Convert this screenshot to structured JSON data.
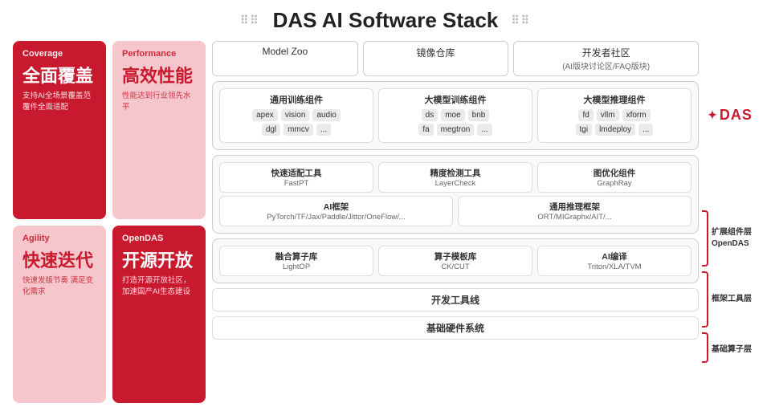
{
  "title": "DAS AI Software Stack",
  "grid_icon": "⠿",
  "left_panel": {
    "top_left": {
      "label": "Coverage",
      "title": "全面覆盖",
      "desc": "支持AI全场景覆盖范\n覆件全面适配"
    },
    "top_right": {
      "label": "Performance",
      "title": "高效性能",
      "desc": "性能达到行业领先水平"
    },
    "bottom_left": {
      "label": "Agility",
      "title": "快速迭代",
      "desc": "快速发版节奏\n满足变化需求"
    },
    "bottom_right": {
      "label": "OpenDAS",
      "title": "开源开放",
      "desc": "打造开源开放社区，\n加速国产AI生态建设"
    }
  },
  "top_boxes": [
    {
      "text": "Model Zoo",
      "sub": ""
    },
    {
      "text": "镜像仓库",
      "sub": ""
    },
    {
      "text": "开发者社区",
      "sub": "(AI版块讨论区/FAQ版块)"
    }
  ],
  "expand_section": {
    "label": "扩展组件层\nOpenDAS",
    "cols": [
      {
        "title": "通用训练组件",
        "rows": [
          [
            "apex",
            "vision",
            "audio"
          ],
          [
            "dgl",
            "mmcv",
            "..."
          ]
        ]
      },
      {
        "title": "大模型训练组件",
        "rows": [
          [
            "ds",
            "moe",
            "bnb"
          ],
          [
            "fa",
            "megtron",
            "..."
          ]
        ]
      },
      {
        "title": "大模型推理组件",
        "rows": [
          [
            "fd",
            "vllm",
            "xform"
          ],
          [
            "tgi",
            "lmdeploy",
            "..."
          ]
        ]
      }
    ]
  },
  "framework_section": {
    "label": "框架工具层",
    "tools": [
      {
        "title": "快速适配工具",
        "sub": "FastPT"
      },
      {
        "title": "精度检测工具",
        "sub": "LayerCheck"
      },
      {
        "title": "图优化组件",
        "sub": "GraphRay"
      }
    ],
    "frameworks": [
      {
        "title": "AI框架",
        "sub": "PyTorch/TF/Jax/Paddle/Jittor/OneFlow/..."
      },
      {
        "title": "通用推理框架",
        "sub": "ORT/MIGraphx/AIT/..."
      }
    ]
  },
  "base_section": {
    "label": "基础算子层",
    "boxes": [
      {
        "title": "融合算子库",
        "sub": "LightOP"
      },
      {
        "title": "算子模板库",
        "sub": "CK/CUT"
      },
      {
        "title": "AI编译",
        "sub": "Triton/XLA/TVM"
      }
    ]
  },
  "bottom_bars": [
    "开发工具线",
    "基础硬件系统"
  ],
  "das_brand": "DAS",
  "colors": {
    "red": "#c8192e",
    "light_red_bg": "#f5d0d4",
    "border": "#ccc"
  }
}
